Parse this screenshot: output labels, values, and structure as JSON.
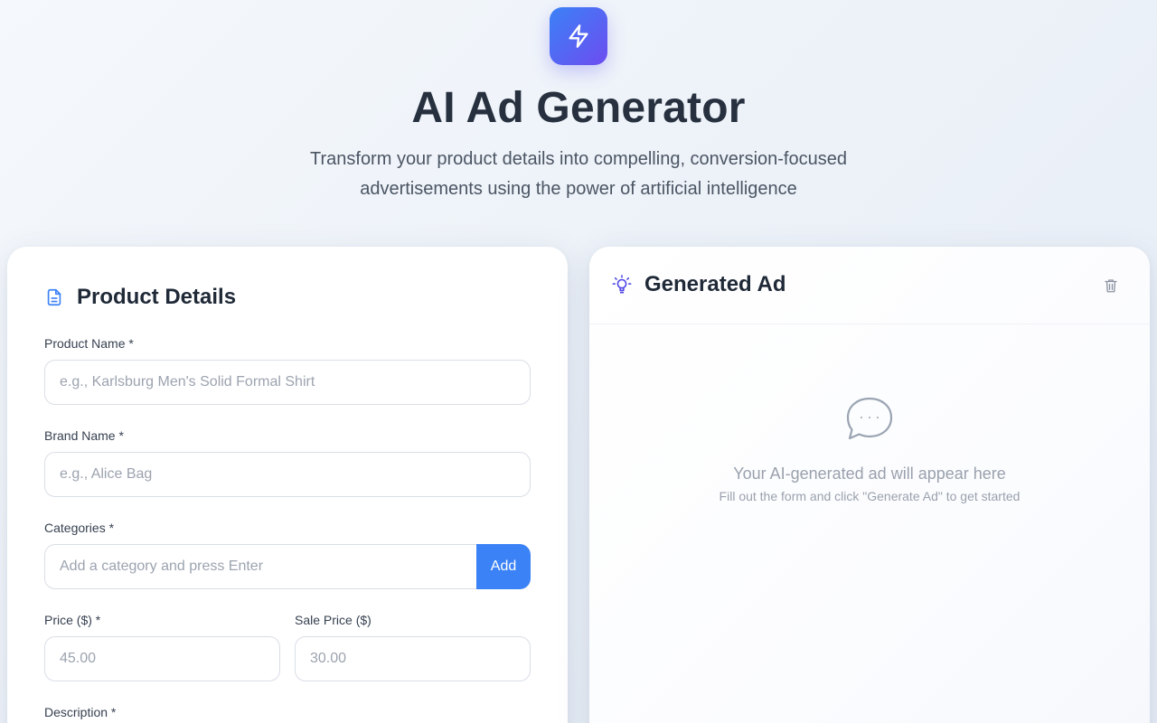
{
  "header": {
    "logo_icon": "lightning-bolt-icon",
    "title": "AI Ad Generator",
    "subtitle": "Transform your product details into compelling, conversion-focused advertisements using the power of artificial intelligence"
  },
  "form": {
    "title": "Product Details",
    "icon": "document-icon",
    "product_name": {
      "label": "Product Name *",
      "placeholder": "e.g., Karlsburg Men's Solid Formal Shirt",
      "value": ""
    },
    "brand_name": {
      "label": "Brand Name *",
      "placeholder": "e.g., Alice Bag",
      "value": ""
    },
    "categories": {
      "label": "Categories *",
      "placeholder": "Add a category and press Enter",
      "add_label": "Add"
    },
    "price": {
      "label": "Price ($) *",
      "placeholder": "45.00",
      "value": ""
    },
    "sale_price": {
      "label": "Sale Price ($)",
      "placeholder": "30.00",
      "value": ""
    },
    "description": {
      "label": "Description *"
    }
  },
  "output": {
    "title": "Generated Ad",
    "icon": "lightbulb-icon",
    "clear_icon": "trash-icon",
    "empty_icon": "chat-bubble-icon",
    "empty_title": "Your AI-generated ad will appear here",
    "empty_hint": "Fill out the form and click \"Generate Ad\" to get started"
  },
  "colors": {
    "accent": "#3b82f6",
    "accent_secondary": "#6d4cf0",
    "heading": "#27303f",
    "muted": "#9aa1ad"
  }
}
